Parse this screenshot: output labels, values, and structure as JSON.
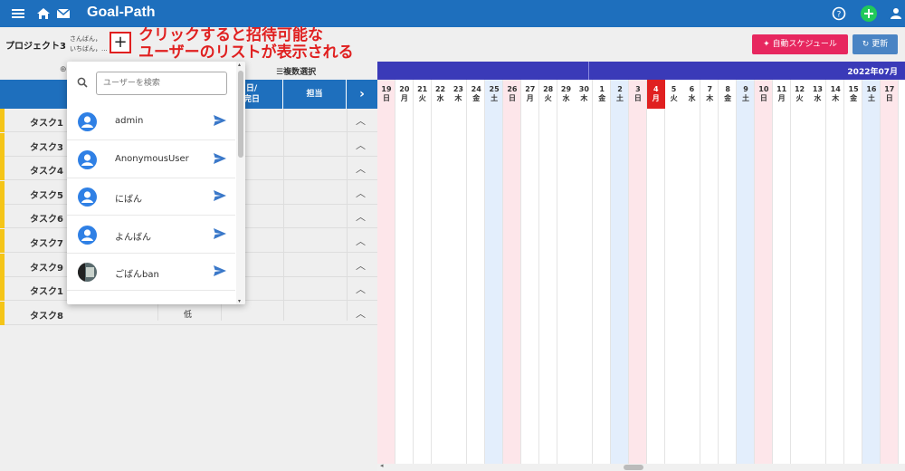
{
  "app": {
    "title": "Goal-Path"
  },
  "project": {
    "name": "プロジェクト3",
    "members": [
      "さんばん，",
      "いちばん，..."
    ],
    "add_symbol": "+"
  },
  "annotation": {
    "line1": "クリックすると招待可能な",
    "line2": "ユーザーのリストが表示される",
    "color": "#e02020"
  },
  "buttons": {
    "auto_schedule": "自動スケジュール",
    "refresh": "更新"
  },
  "toolbar": {
    "multi_select": "☰複数選択"
  },
  "table": {
    "headers": {
      "task_top": "タ",
      "task_bottom": "ア",
      "date_top": "日/",
      "date_bottom": "完日",
      "owner": "担当",
      "next": "›"
    },
    "rows": [
      {
        "name": "タスク1",
        "priority": ""
      },
      {
        "name": "タスク3",
        "priority": ""
      },
      {
        "name": "タスク4",
        "priority": ""
      },
      {
        "name": "タスク5",
        "priority": ""
      },
      {
        "name": "タスク6",
        "priority": ""
      },
      {
        "name": "タスク7",
        "priority": ""
      },
      {
        "name": "タスク9",
        "priority": ""
      },
      {
        "name": "タスク1",
        "priority": ""
      },
      {
        "name": "タスク8",
        "priority": "低"
      }
    ]
  },
  "gantt": {
    "month": "2022年07月",
    "days": [
      {
        "n": "19",
        "w": "日"
      },
      {
        "n": "20",
        "w": "月"
      },
      {
        "n": "21",
        "w": "火"
      },
      {
        "n": "22",
        "w": "水"
      },
      {
        "n": "23",
        "w": "木"
      },
      {
        "n": "24",
        "w": "金"
      },
      {
        "n": "25",
        "w": "土"
      },
      {
        "n": "26",
        "w": "日"
      },
      {
        "n": "27",
        "w": "月"
      },
      {
        "n": "28",
        "w": "火"
      },
      {
        "n": "29",
        "w": "水"
      },
      {
        "n": "30",
        "w": "木"
      },
      {
        "n": "1",
        "w": "金"
      },
      {
        "n": "2",
        "w": "土"
      },
      {
        "n": "3",
        "w": "日"
      },
      {
        "n": "4",
        "w": "月"
      },
      {
        "n": "5",
        "w": "火"
      },
      {
        "n": "6",
        "w": "水"
      },
      {
        "n": "7",
        "w": "木"
      },
      {
        "n": "8",
        "w": "金"
      },
      {
        "n": "9",
        "w": "土"
      },
      {
        "n": "10",
        "w": "日"
      },
      {
        "n": "11",
        "w": "月"
      },
      {
        "n": "12",
        "w": "火"
      },
      {
        "n": "13",
        "w": "水"
      },
      {
        "n": "14",
        "w": "木"
      },
      {
        "n": "15",
        "w": "金"
      },
      {
        "n": "16",
        "w": "土"
      },
      {
        "n": "17",
        "w": "日"
      }
    ],
    "today": "4",
    "colors": {
      "sunday": "#fde6ea",
      "saturday": "#e3eefc",
      "today": "#e02020",
      "month_bar": "#3a3ab8"
    }
  },
  "popup": {
    "search_placeholder": "ユーザーを検索",
    "users": [
      {
        "name": "admin",
        "avatar": "person-icon"
      },
      {
        "name": "AnonymousUser",
        "avatar": "person-icon"
      },
      {
        "name": "にばん",
        "avatar": "person-icon"
      },
      {
        "name": "よんばん",
        "avatar": "person-icon"
      },
      {
        "name": "ごばんban",
        "avatar": "photo-avatar"
      }
    ]
  },
  "colors": {
    "topbar": "#1e6fbd",
    "accent_pink": "#e7275f",
    "accent_blue": "#4a84c4",
    "task_marker": "#f5c518"
  }
}
